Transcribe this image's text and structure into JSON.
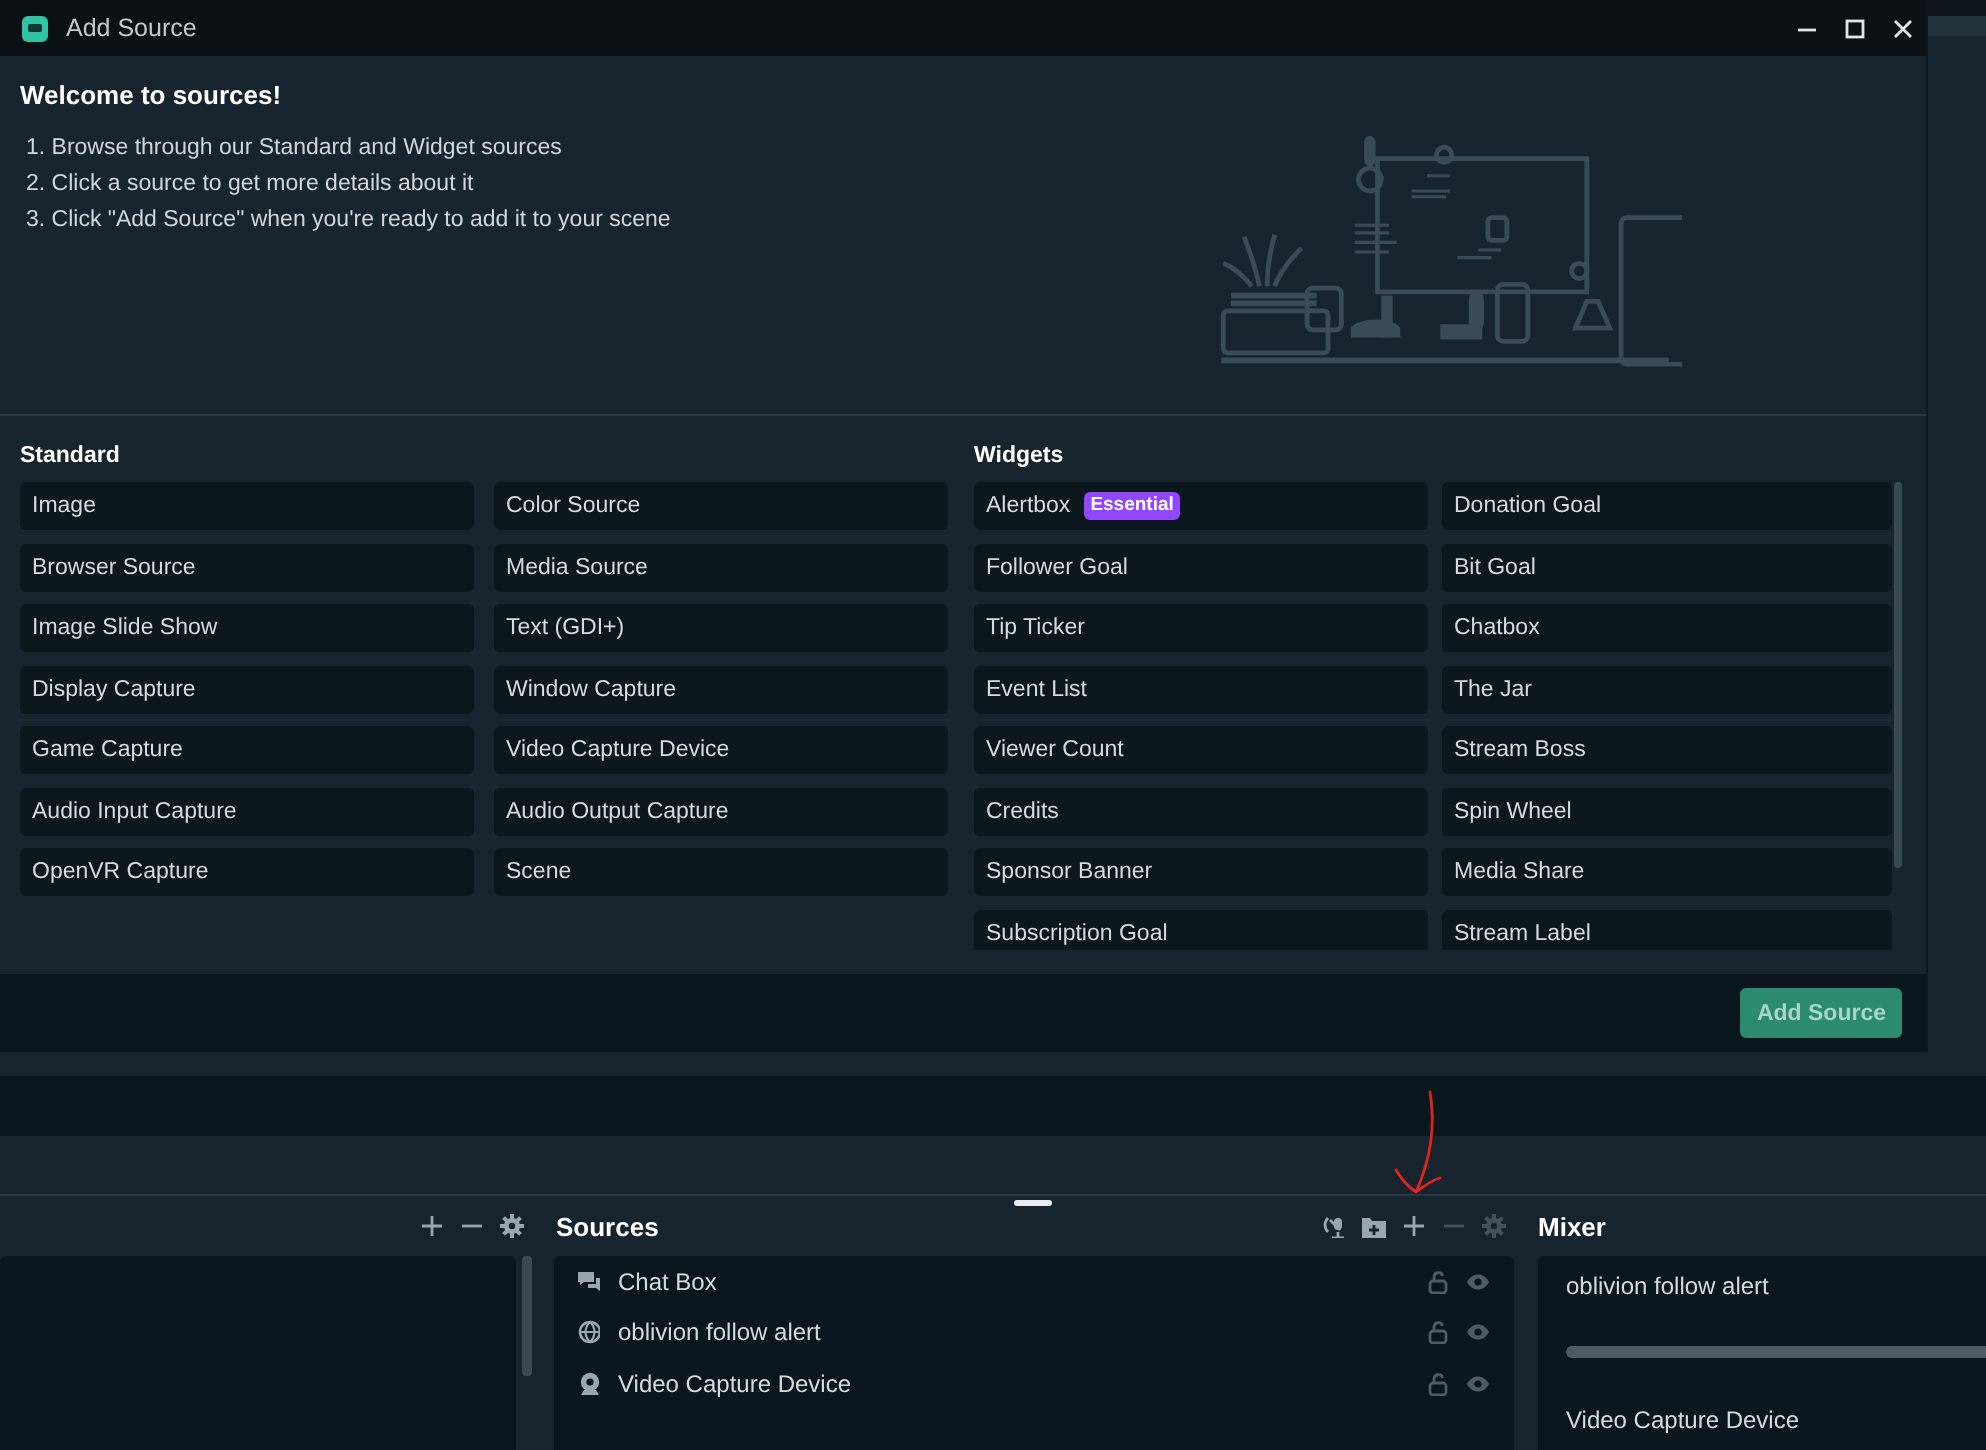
{
  "window": {
    "title": "Add Source"
  },
  "welcome": {
    "title": "Welcome to sources!",
    "steps": [
      "1. Browse through our Standard and Widget sources",
      "2. Click a source to get more details about it",
      "3. Click \"Add Source\" when you're ready to add it to your scene"
    ]
  },
  "standard": {
    "heading": "Standard",
    "items": [
      {
        "label": "Image"
      },
      {
        "label": "Color Source"
      },
      {
        "label": "Browser Source"
      },
      {
        "label": "Media Source"
      },
      {
        "label": "Image Slide Show"
      },
      {
        "label": "Text (GDI+)"
      },
      {
        "label": "Display Capture"
      },
      {
        "label": "Window Capture"
      },
      {
        "label": "Game Capture"
      },
      {
        "label": "Video Capture Device"
      },
      {
        "label": "Audio Input Capture"
      },
      {
        "label": "Audio Output Capture"
      },
      {
        "label": "OpenVR Capture"
      },
      {
        "label": "Scene"
      }
    ]
  },
  "widgets": {
    "heading": "Widgets",
    "items": [
      {
        "label": "Alertbox",
        "badge": "Essential"
      },
      {
        "label": "Donation Goal"
      },
      {
        "label": "Follower Goal"
      },
      {
        "label": "Bit Goal"
      },
      {
        "label": "Tip Ticker"
      },
      {
        "label": "Chatbox"
      },
      {
        "label": "Event List"
      },
      {
        "label": "The Jar"
      },
      {
        "label": "Viewer Count"
      },
      {
        "label": "Stream Boss"
      },
      {
        "label": "Credits"
      },
      {
        "label": "Spin Wheel"
      },
      {
        "label": "Sponsor Banner"
      },
      {
        "label": "Media Share"
      },
      {
        "label": "Subscription Goal"
      },
      {
        "label": "Stream Label"
      }
    ]
  },
  "footer": {
    "button": "Add Source"
  },
  "sources": {
    "title": "Sources",
    "items": [
      {
        "name": "Chat Box",
        "kind": "chat"
      },
      {
        "name": "oblivion follow alert",
        "kind": "browser"
      },
      {
        "name": "Video Capture Device",
        "kind": "webcam"
      }
    ]
  },
  "mixer": {
    "title": "Mixer",
    "channels": [
      {
        "name": "oblivion follow alert"
      },
      {
        "name": "Video Capture Device"
      }
    ]
  }
}
